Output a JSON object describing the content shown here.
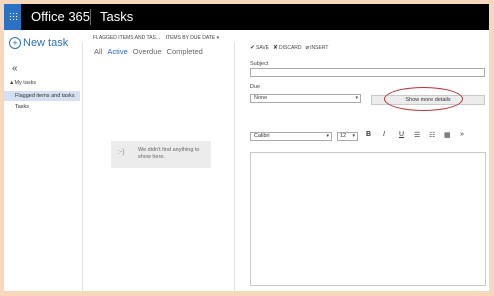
{
  "header": {
    "app_title": "Office 365",
    "section_title": "Tasks"
  },
  "sidebar": {
    "new_task_label": "New task",
    "collapse_glyph": "«",
    "group_label": "▲My tasks",
    "items": [
      {
        "label": "Flagged items and tasks",
        "selected": true
      },
      {
        "label": "Tasks",
        "selected": false
      }
    ]
  },
  "list": {
    "view_label": "FLAGGED ITEMS AND TAS...",
    "sort_label": "ITEMS BY DUE DATE",
    "filters": [
      "All",
      "Active",
      "Overdue",
      "Completed"
    ],
    "active_filter": "Active",
    "empty_face": ":-)",
    "empty_message": "We didn't find anything to show here."
  },
  "editor": {
    "commands": [
      {
        "icon": "check-icon",
        "glyph": "✔",
        "label": "SAVE"
      },
      {
        "icon": "discard-icon",
        "glyph": "✘",
        "label": "DISCARD"
      },
      {
        "icon": "paperclip-icon",
        "glyph": "⌀",
        "label": "INSERT"
      }
    ],
    "subject_label": "Subject",
    "subject_value": "",
    "due_label": "Due",
    "due_value": "None",
    "more_details_label": "Show more details",
    "font_name": "Calibri",
    "font_size": "12",
    "format_buttons": [
      "B",
      "I",
      "U"
    ]
  },
  "colors": {
    "accent": "#2c6ebc",
    "topbar": "#000000",
    "waffle": "#2b72c6",
    "highlight_oval": "#b53434"
  }
}
